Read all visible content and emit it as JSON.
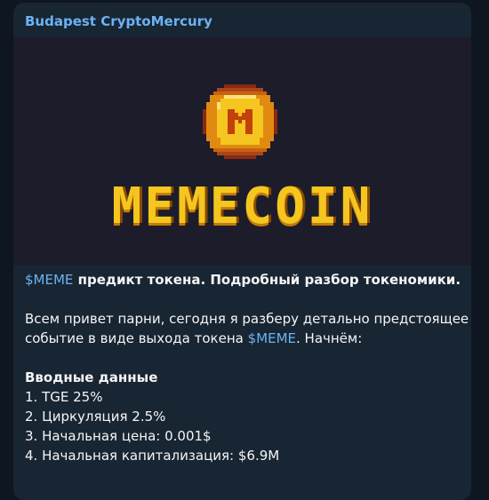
{
  "channel": {
    "name": "Budapest CryptoMercury"
  },
  "media": {
    "logo_text": "MEMECOIN",
    "coin_letter": "M",
    "colors": {
      "gold": "#f4c61f",
      "dark_gold": "#c27a0c",
      "background": "#1c1c2a"
    }
  },
  "message": {
    "headline_ticker": "$MEME",
    "headline_rest": " предикт токена. Подробный разбор токеномики.",
    "intro_line1": "Всем привет парни, сегодня я разберу детально предстоящее",
    "intro_line2_before": "событие в виде выхода токена ",
    "intro_ticker": "$MEME",
    "intro_line2_after": ". Начнём:",
    "section_title": "Вводные данные",
    "items": [
      "1. TGE 25%",
      "2. Циркуляция 2.5%",
      "3. Начальная цена: 0.001$",
      "4. Начальная капитализация: $6.9M"
    ]
  },
  "colors": {
    "accent": "#6ab3f3",
    "bubble": "#182533",
    "page": "#0e1621"
  }
}
